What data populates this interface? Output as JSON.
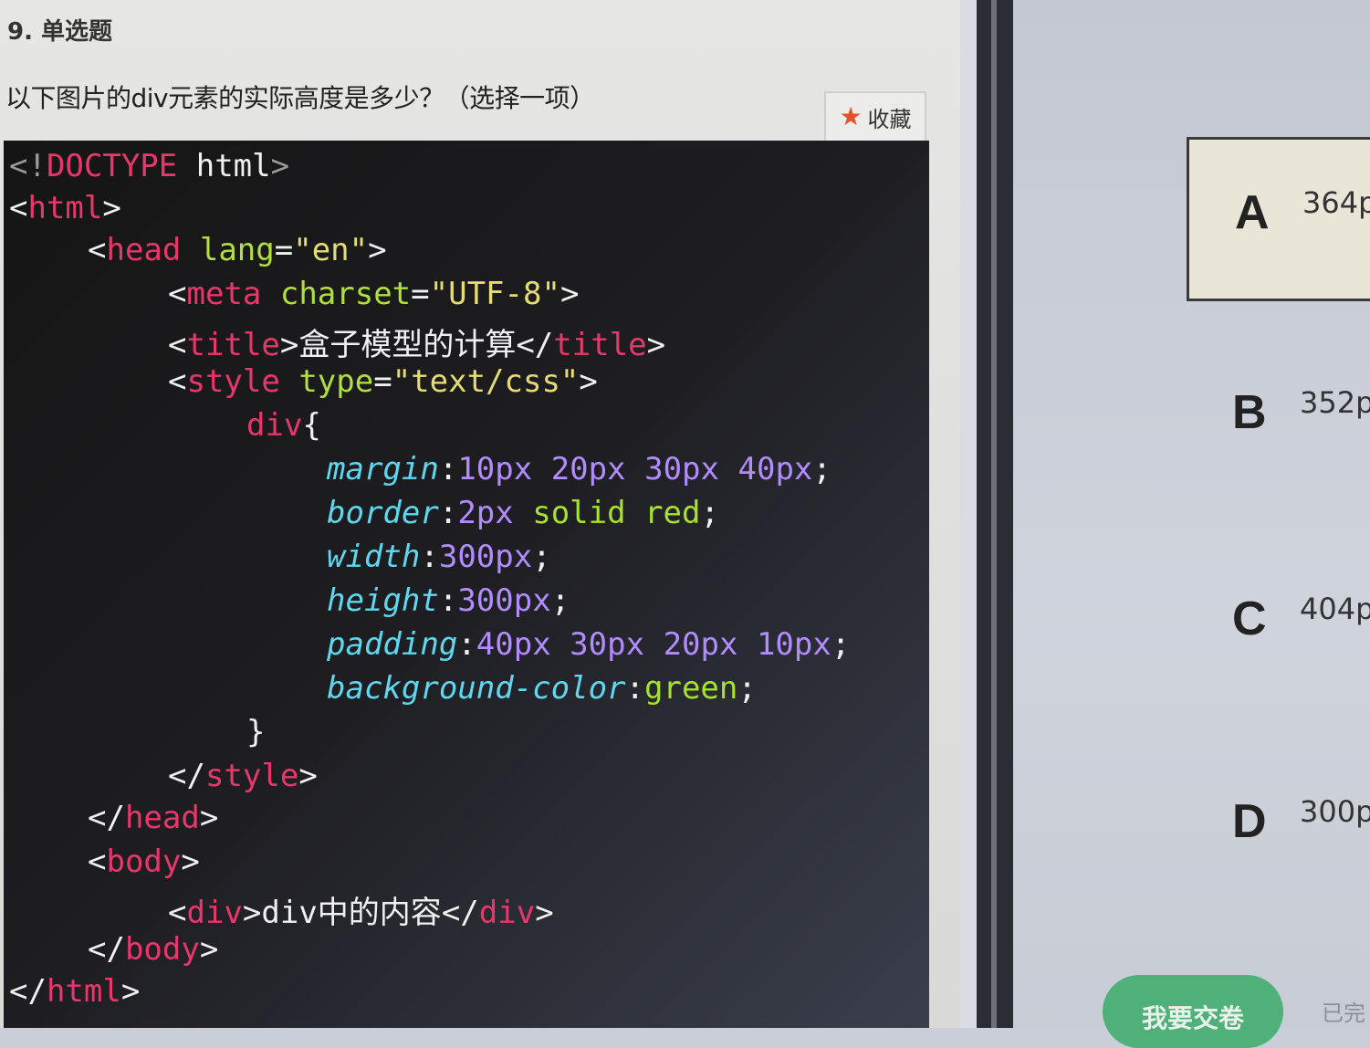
{
  "question": {
    "number_label": "9. 单选题",
    "text": "以下图片的div元素的实际高度是多少？（选择一项）",
    "favorite_label": "收藏"
  },
  "code": {
    "lines": [
      "<!DOCTYPE html>",
      "<html>",
      "<head lang=\"en\">",
      "<meta charset=\"UTF-8\">",
      "<title>盒子模型的计算</title>",
      "<style type=\"text/css\">",
      "div{",
      "margin:10px 20px 30px 40px;",
      "border:2px solid red;",
      "width:300px;",
      "height:300px;",
      "padding:40px 30px 20px 10px;",
      "background-color:green;",
      "}",
      "</style>",
      "</head>",
      "<body>",
      "<div>div中的内容</div>",
      "</body>",
      "</html>"
    ]
  },
  "options": [
    {
      "letter": "A",
      "value": "364p"
    },
    {
      "letter": "B",
      "value": "352p"
    },
    {
      "letter": "C",
      "value": "404p"
    },
    {
      "letter": "D",
      "value": "300p"
    }
  ],
  "footer": {
    "submit_label": "我要交卷",
    "status_text": "已完"
  },
  "colors": {
    "code_background": "#151515",
    "tag_red": "#e8376a",
    "attr_green": "#b0df3e",
    "string_yellow": "#e6db74",
    "css_property_cyan": "#5fd7ef",
    "css_number_purple": "#b28cff",
    "submit_green": "#4fb07a",
    "favorite_star": "#e5512a"
  }
}
